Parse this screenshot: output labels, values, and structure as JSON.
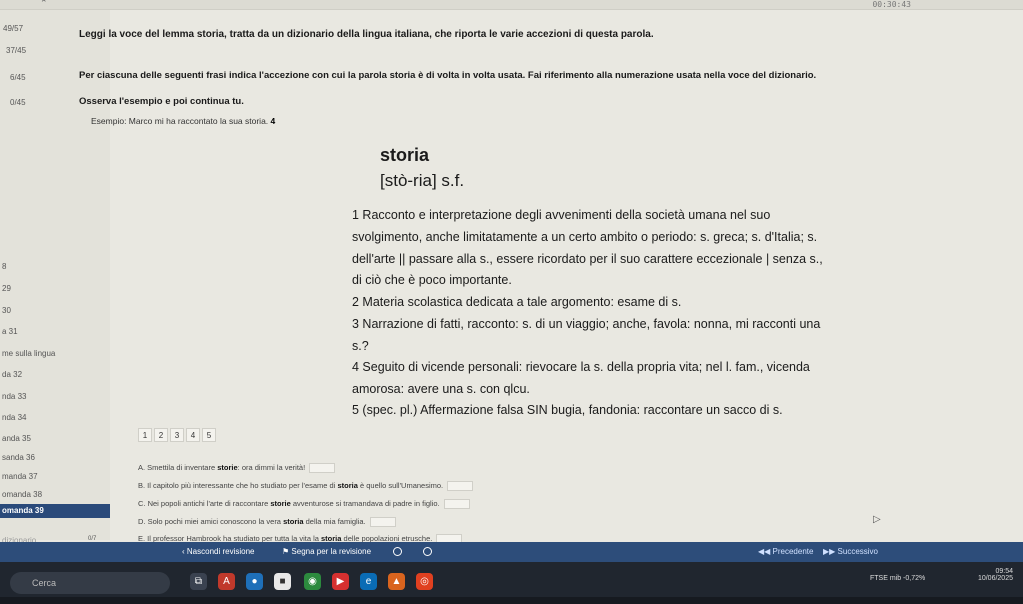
{
  "timer": "00:30:43",
  "sidebar": {
    "scores": [
      "49/57",
      "37/45",
      "6/45",
      "0/45"
    ],
    "items": [
      {
        "label": "8",
        "state": "normal"
      },
      {
        "label": "29",
        "state": "normal"
      },
      {
        "label": "30",
        "state": "normal"
      },
      {
        "label": "a 31",
        "state": "normal"
      },
      {
        "label": "me sulla lingua",
        "state": "normal"
      },
      {
        "label": "da 32",
        "state": "normal"
      },
      {
        "label": "nda 33",
        "state": "normal"
      },
      {
        "label": "nda 34",
        "state": "normal"
      },
      {
        "label": "anda 35",
        "state": "normal"
      },
      {
        "label": "sanda 36",
        "state": "normal"
      },
      {
        "label": "manda 37",
        "state": "normal"
      },
      {
        "label": "omanda 38",
        "state": "normal"
      },
      {
        "label": "omanda 39",
        "state": "active"
      },
      {
        "label": "",
        "state": "faint"
      },
      {
        "label": "dizionario",
        "state": "faint"
      }
    ],
    "page_counter": "0/7"
  },
  "instructions": {
    "line1": "Leggi la voce del lemma storia, tratta da un dizionario della lingua italiana, che riporta le varie accezioni di questa parola.",
    "line2": "Per ciascuna delle seguenti frasi indica l'accezione con cui la parola storia è di volta in volta usata. Fai riferimento alla numerazione usata nella voce del dizionario.",
    "line3": "Osserva l'esempio e poi continua tu.",
    "example_text": "Esempio: Marco mi ha raccontato la sua storia.",
    "example_answer": "4"
  },
  "dictionary": {
    "word": "storia",
    "pronunciation": "[stò-ria] s.f.",
    "lines": [
      "1 Racconto e interpretazione degli avvenimenti della società umana nel suo",
      "svolgimento, anche limitatamente a un certo ambito o periodo: s. greca; s. d'Italia; s.",
      "dell'arte || passare alla s., essere ricordato per il suo carattere eccezionale | senza s.,",
      "di ciò che è poco importante.",
      "2 Materia scolastica dedicata a tale argomento: esame di s.",
      "3 Narrazione di fatti, racconto: s. di un viaggio; anche, favola: nonna, mi racconti una",
      "s.?",
      "4 Seguito di vicende personali: rievocare la s. della propria vita; nel l. fam., vicenda",
      "amorosa: avere una s. con qlcu.",
      "5 (spec. pl.) Affermazione falsa SIN bugia, fandonia: raccontare un sacco di s."
    ]
  },
  "numbers": [
    "1",
    "2",
    "3",
    "4",
    "5"
  ],
  "sentences": [
    {
      "prefix": "A. Smettila di inventare ",
      "keyword": "storie",
      "suffix": ": ora dimmi la verità!"
    },
    {
      "prefix": "B. Il capitolo più interessante che ho studiato per l'esame di ",
      "keyword": "storia",
      "suffix": " è quello sull'Umanesimo."
    },
    {
      "prefix": "C. Nei popoli antichi l'arte di raccontare ",
      "keyword": "storie",
      "suffix": " avventurose si tramandava di padre in figlio."
    },
    {
      "prefix": "D. Solo pochi miei amici conoscono la vera ",
      "keyword": "storia",
      "suffix": " della mia famiglia."
    },
    {
      "prefix": "E. Il professor Hambrook ha studiato per tutta la vita la ",
      "keyword": "storia",
      "suffix": " delle popolazioni etrusche."
    }
  ],
  "navbar": {
    "hide_review": "Nascondi revisione",
    "mark_review": "Segna per la revisione",
    "previous": "Precedente",
    "next": "Successivo"
  },
  "taskbar": {
    "search_placeholder": "Cerca",
    "news": "FTSE mib -0,72%",
    "time": "09:54",
    "date": "10/06/2025"
  }
}
